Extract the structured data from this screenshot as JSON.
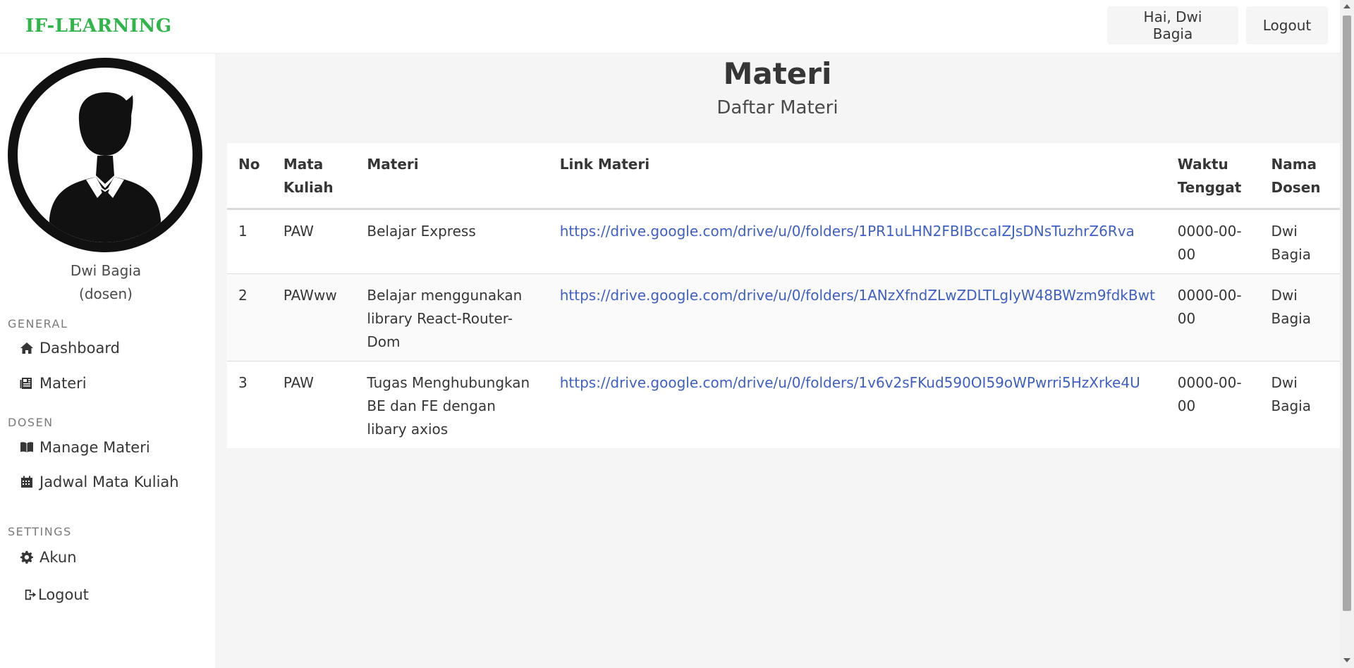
{
  "navbar": {
    "brand": "IF-LEARNING",
    "greeting": "Hai, Dwi Bagia",
    "logout": "Logout"
  },
  "sidebar": {
    "user_name": "Dwi Bagia",
    "user_role": "(dosen)",
    "sections": {
      "general": "GENERAL",
      "dosen": "DOSEN",
      "settings": "SETTINGS"
    },
    "items": {
      "dashboard": {
        "label": "Dashboard",
        "icon": "home-icon"
      },
      "materi": {
        "label": "Materi",
        "icon": "newspaper-icon"
      },
      "manage_materi": {
        "label": "Manage Materi",
        "icon": "book-icon"
      },
      "jadwal": {
        "label": "Jadwal Mata Kuliah",
        "icon": "calendar-icon"
      },
      "akun": {
        "label": "Akun",
        "icon": "gear-icon"
      },
      "logout": {
        "label": "Logout",
        "icon": "sign-out-icon"
      }
    }
  },
  "main": {
    "title": "Materi",
    "subtitle": "Daftar Materi",
    "table": {
      "headers": {
        "no": "No",
        "mata_kuliah": "Mata Kuliah",
        "materi": "Materi",
        "link": "Link Materi",
        "waktu": "Waktu Tenggat",
        "dosen": "Nama Dosen"
      },
      "rows": [
        {
          "no": "1",
          "mata_kuliah": "PAW",
          "materi": "Belajar Express",
          "link": "https://drive.google.com/drive/u/0/folders/1PR1uLHN2FBIBccaIZJsDNsTuzhrZ6Rva",
          "waktu": "0000-00-00",
          "dosen": "Dwi Bagia"
        },
        {
          "no": "2",
          "mata_kuliah": "PAWww",
          "materi": "Belajar menggunakan library React-Router-Dom",
          "link": "https://drive.google.com/drive/u/0/folders/1ANzXfndZLwZDLTLgIyW48BWzm9fdkBwt",
          "waktu": "0000-00-00",
          "dosen": "Dwi Bagia"
        },
        {
          "no": "3",
          "mata_kuliah": "PAW",
          "materi": "Tugas Menghubungkan BE dan FE dengan libary axios",
          "link": "https://drive.google.com/drive/u/0/folders/1v6v2sFKud590OI59oWPwrri5HzXrke4U",
          "waktu": "0000-00-00",
          "dosen": "Dwi Bagia"
        }
      ]
    }
  },
  "colors": {
    "brand": "#2fb54a",
    "link": "#3e5fc4",
    "main_bg": "#f5f5f5"
  }
}
